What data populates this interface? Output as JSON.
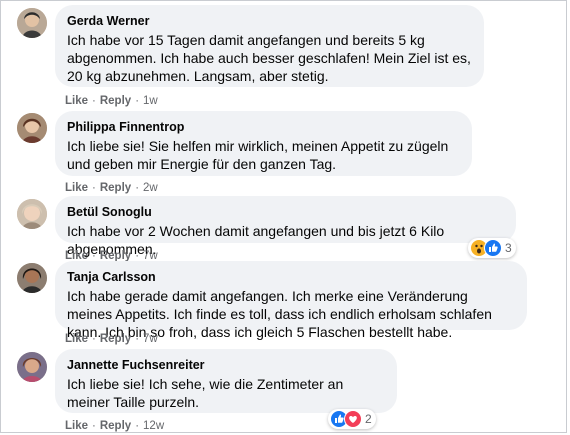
{
  "actions": {
    "like": "Like",
    "reply": "Reply"
  },
  "comments": [
    {
      "author": "Gerda Werner",
      "text": "Ich habe vor 15 Tagen damit angefangen und bereits 5 kg abgenommen. Ich habe auch besser geschlafen! Mein Ziel ist es, 20 kg abzunehmen. Langsam, aber stetig.",
      "time": "1w"
    },
    {
      "author": "Philippa Finnentrop",
      "text": "Ich liebe sie! Sie helfen mir wirklich, meinen Appetit zu zügeln und geben mir Energie für den ganzen Tag.",
      "time": "2w"
    },
    {
      "author": "Betül Sonoglu",
      "text": "Ich habe vor 2 Wochen damit angefangen und bis jetzt 6 Kilo abgenommen.",
      "time": "7w",
      "reactions": {
        "icons": [
          "wow-reaction-icon",
          "like-reaction-icon"
        ],
        "count": "3"
      }
    },
    {
      "author": "Tanja Carlsson",
      "text": "Ich habe gerade damit angefangen. Ich merke eine Veränderung meines Appetits. Ich finde es toll, dass ich endlich erholsam schlafen kann. Ich bin so froh, dass ich gleich 5 Flaschen bestellt habe.",
      "time": "7w"
    },
    {
      "author": "Jannette Fuchsenreiter",
      "text": "Ich liebe sie! Ich sehe, wie die Zentimeter an meiner Taille purzeln.",
      "time": "12w",
      "reactions": {
        "icons": [
          "like-reaction-icon",
          "love-reaction-icon"
        ],
        "count": "2"
      }
    }
  ],
  "colors": {
    "bubble": "#f0f2f5",
    "meta": "#65676b",
    "like_blue": "#1877f2",
    "love_red": "#f33e58",
    "wow_yellow": "#f7b125"
  }
}
